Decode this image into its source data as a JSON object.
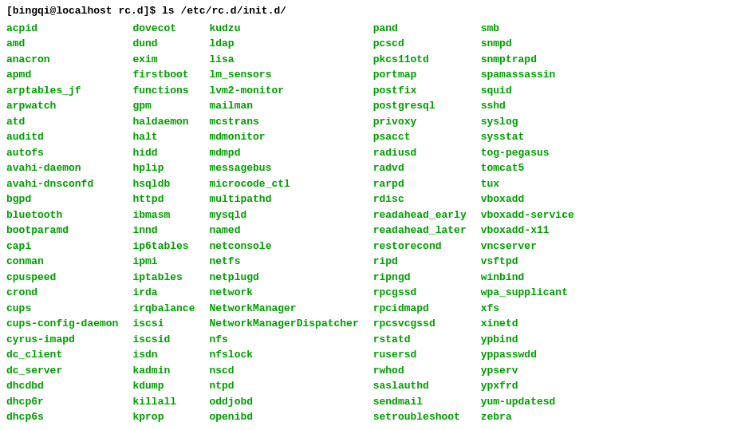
{
  "prompt": {
    "text": "[bingqi@localhost rc.d]$ ls /etc/rc.d/init.d/"
  },
  "columns": [
    [
      "acpid",
      "amd",
      "anacron",
      "apmd",
      "arptables_jf",
      "arpwatch",
      "atd",
      "auditd",
      "autofs",
      "avahi-daemon",
      "avahi-dnsconfd",
      "bgpd",
      "bluetooth",
      "bootparamd",
      "capi",
      "conman",
      "cpuspeed",
      "crond",
      "cups",
      "cups-config-daemon",
      "cyrus-imapd",
      "dc_client",
      "dc_server",
      "dhcdbd",
      "dhcp6r",
      "dhcp6s"
    ],
    [
      "dovecot",
      "dund",
      "exim",
      "firstboot",
      "functions",
      "gpm",
      "haldaemon",
      "halt",
      "hidd",
      "hplip",
      "hsqldb",
      "httpd",
      "ibmasm",
      "innd",
      "ip6tables",
      "ipmi",
      "iptables",
      "irda",
      "irqbalance",
      "iscsi",
      "iscsid",
      "isdn",
      "kadmin",
      "kdump",
      "killall",
      "kprop"
    ],
    [
      "kudzu",
      "ldap",
      "lisa",
      "lm_sensors",
      "lvm2-monitor",
      "mailman",
      "mcstrans",
      "mdmonitor",
      "mdmpd",
      "messagebus",
      "microcode_ctl",
      "multipathd",
      "mysqld",
      "named",
      "netconsole",
      "netfs",
      "netplugd",
      "network",
      "NetworkManager",
      "NetworkManagerDispatcher",
      "nfs",
      "nfslock",
      "nscd",
      "ntpd",
      "oddjobd",
      "openibd"
    ],
    [
      "pand",
      "pcscd",
      "pkcs11otd",
      "portmap",
      "postfix",
      "postgresql",
      "privoxy",
      "psacct",
      "radiusd",
      "radvd",
      "rarpd",
      "rdisc",
      "readahead_early",
      "readahead_later",
      "restorecond",
      "ripd",
      "ripngd",
      "rpcgssd",
      "rpcidmapd",
      "rpcsvcgssd",
      "rstatd",
      "rusersd",
      "rwhod",
      "saslauthd",
      "sendmail",
      "setroubleshoot"
    ],
    [
      "smb",
      "snmpd",
      "snmptrapd",
      "spamassassin",
      "squid",
      "sshd",
      "syslog",
      "sysstat",
      "tog-pegasus",
      "tomcat5",
      "tux",
      "vboxadd",
      "vboxadd-service",
      "vboxadd-x11",
      "vncserver",
      "vsftpd",
      "winbind",
      "wpa_supplicant",
      "xfs",
      "xinetd",
      "ypbind",
      "yppasswdd",
      "ypserv",
      "ypxfrd",
      "yum-updatesd",
      "zebra"
    ]
  ]
}
